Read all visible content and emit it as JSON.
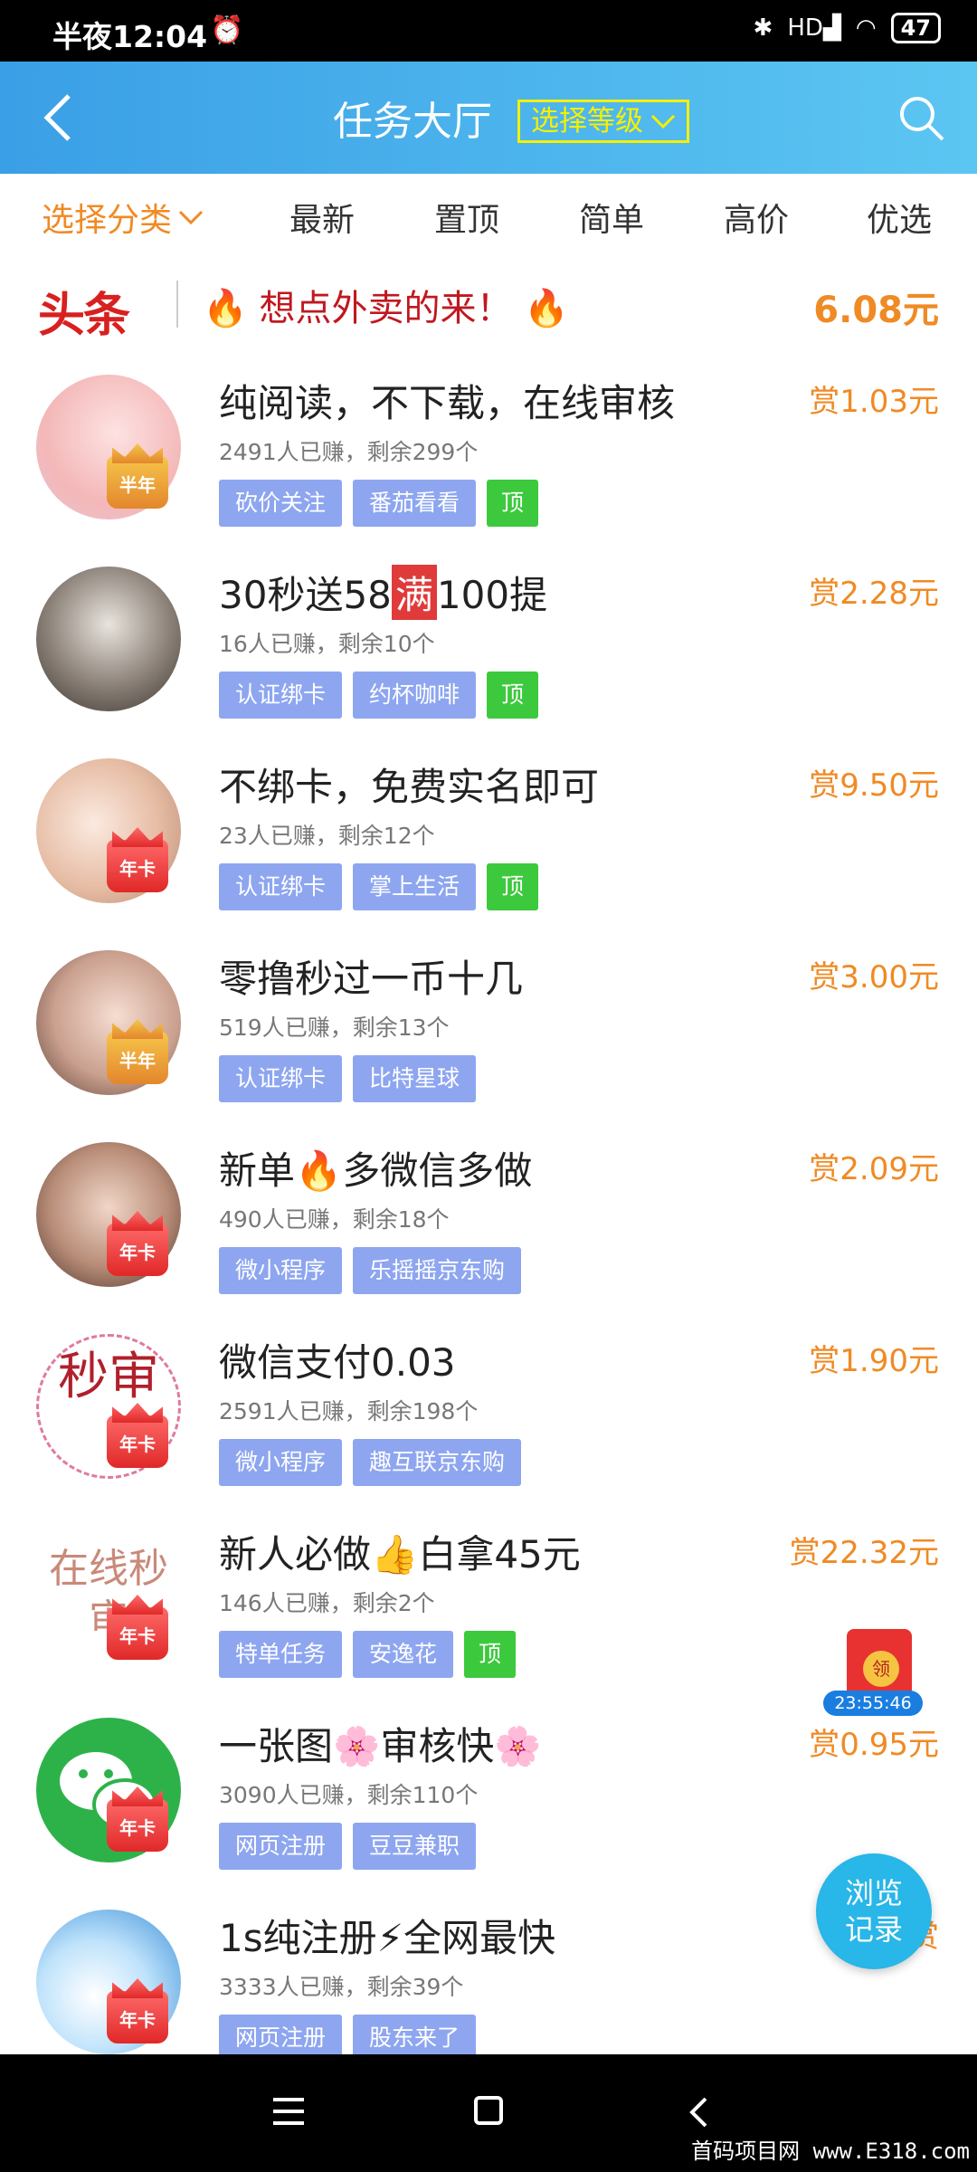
{
  "status_bar": {
    "time": "半夜12:04",
    "battery": "47",
    "bluetooth": "bluetooth-icon",
    "signal": "HD",
    "wifi": "wifi-icon"
  },
  "header": {
    "title": "任务大厅",
    "level_select": "选择等级"
  },
  "categories": {
    "select": "选择分类",
    "tabs": [
      "最新",
      "置顶",
      "简单",
      "高价",
      "优选"
    ]
  },
  "headline": {
    "logo": "头条",
    "text": "想点外卖的来！",
    "price": "6.08元"
  },
  "tasks": [
    {
      "title": "纯阅读，不下载，在线审核",
      "reward": "赏1.03元",
      "stats": "2491人已赚，剩余299个",
      "tags": [
        "砍价关注",
        "番茄看看"
      ],
      "top": "顶",
      "badge": "半年"
    },
    {
      "title_a": "30秒送58",
      "title_mark": "满",
      "title_b": "100提",
      "reward": "赏2.28元",
      "stats": "16人已赚，剩余10个",
      "tags": [
        "认证绑卡",
        "约杯咖啡"
      ],
      "top": "顶"
    },
    {
      "title": "不绑卡，免费实名即可",
      "reward": "赏9.50元",
      "stats": "23人已赚，剩余12个",
      "tags": [
        "认证绑卡",
        "掌上生活"
      ],
      "top": "顶",
      "badge": "年卡"
    },
    {
      "title": "零撸秒过一币十几",
      "reward": "赏3.00元",
      "stats": "519人已赚，剩余13个",
      "tags": [
        "认证绑卡",
        "比特星球"
      ],
      "badge": "半年"
    },
    {
      "title_a": "新单",
      "title_b": "多微信多做",
      "reward": "赏2.09元",
      "stats": "490人已赚，剩余18个",
      "tags": [
        "微小程序",
        "乐摇摇京东购"
      ],
      "badge": "年卡"
    },
    {
      "title": "微信支付0.03",
      "reward": "赏1.90元",
      "stats": "2591人已赚，剩余198个",
      "tags": [
        "微小程序",
        "趣互联京东购"
      ],
      "badge": "年卡",
      "avatar_text": "秒审"
    },
    {
      "title_a": "新人必做",
      "title_b": "白拿45元",
      "reward": "赏22.32元",
      "stats": "146人已赚，剩余2个",
      "tags": [
        "特单任务",
        "安逸花"
      ],
      "top": "顶",
      "badge": "年卡",
      "avatar_text": "在线秒审"
    },
    {
      "title_a": "一张图",
      "title_b": "审核快",
      "reward": "赏0.95元",
      "stats": "3090人已赚，剩余110个",
      "tags": [
        "网页注册",
        "豆豆兼职"
      ],
      "badge": "年卡"
    },
    {
      "title_a": "1s纯注册",
      "title_b": "全网最快",
      "reward": "赏",
      "stats": "3333人已赚，剩余39个",
      "tags": [
        "网页注册",
        "股东来了"
      ],
      "badge": "年卡"
    }
  ],
  "redpack": {
    "coin": "领",
    "timer": "23:55:46"
  },
  "float_button": {
    "line1": "浏览",
    "line2": "记录"
  },
  "watermark": "首码项目网 www.E318.com",
  "colors": {
    "accent": "#f08a24",
    "header": "#3a9fe6",
    "tag": "#8ea6f0",
    "top_tag": "#3dc93d"
  }
}
